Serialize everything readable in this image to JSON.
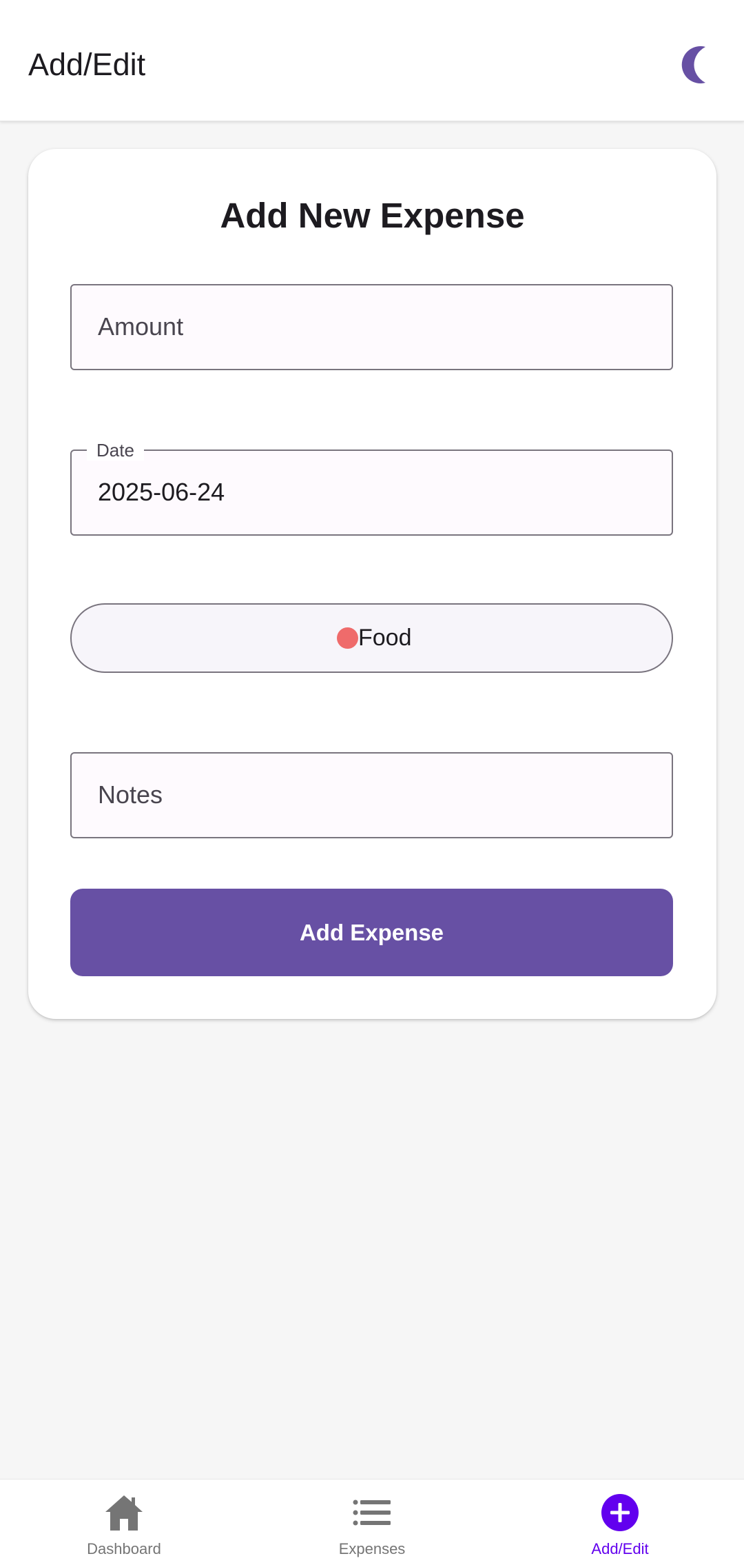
{
  "app_bar": {
    "title": "Add/Edit",
    "theme_toggle_icon": "moon-icon",
    "accent_color": "#6750a4"
  },
  "form": {
    "title": "Add New Expense",
    "amount": {
      "placeholder": "Amount",
      "value": ""
    },
    "date": {
      "label": "Date",
      "value": "2025-06-24"
    },
    "category": {
      "label": "Food",
      "dot_color": "#ef6b6b"
    },
    "notes": {
      "placeholder": "Notes",
      "value": ""
    },
    "submit_label": "Add Expense"
  },
  "bottom_nav": {
    "items": [
      {
        "label": "Dashboard",
        "icon": "home-icon",
        "active": false
      },
      {
        "label": "Expenses",
        "icon": "list-icon",
        "active": false
      },
      {
        "label": "Add/Edit",
        "icon": "add-circle-icon",
        "active": true
      }
    ],
    "active_color": "#6200ee",
    "inactive_color": "#757575"
  }
}
